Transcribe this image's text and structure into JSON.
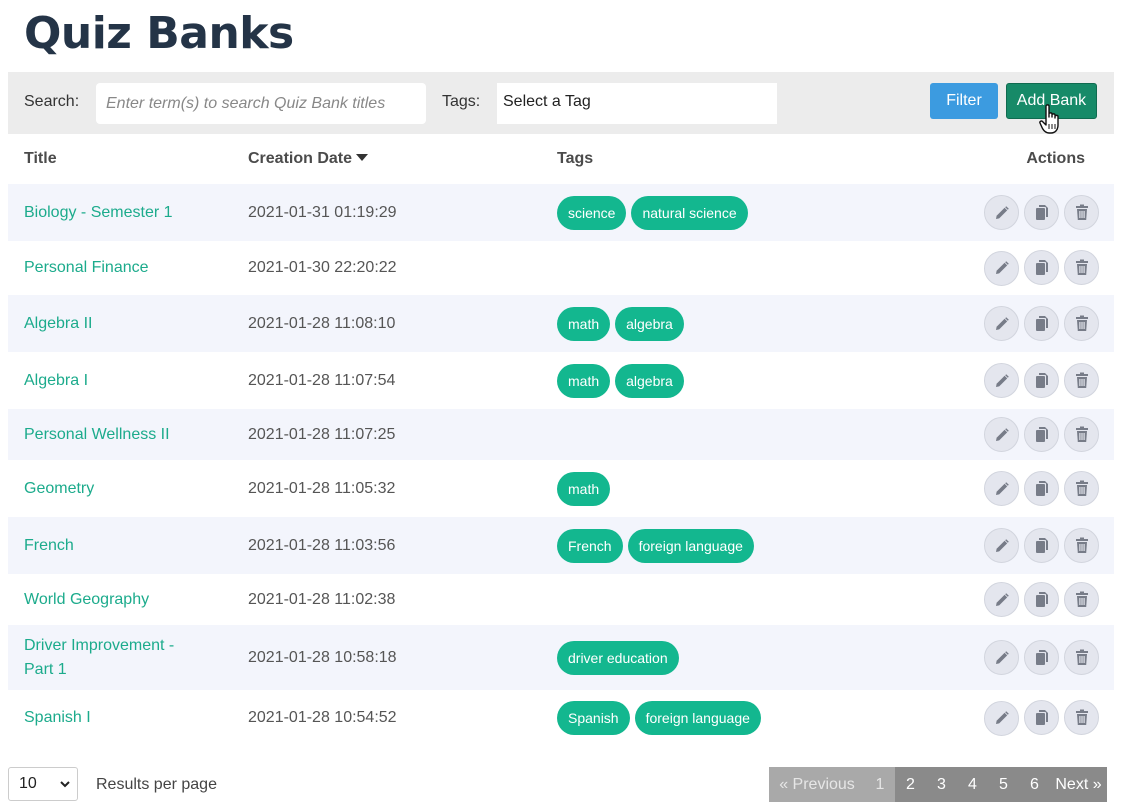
{
  "page": {
    "title": "Quiz Banks"
  },
  "filter": {
    "search_label": "Search:",
    "search_placeholder": "Enter term(s) to search Quiz Bank titles",
    "tags_label": "Tags:",
    "tags_value": "Select a Tag",
    "filter_button": "Filter",
    "add_button": "Add Bank"
  },
  "table": {
    "headers": {
      "title": "Title",
      "date": "Creation Date",
      "tags": "Tags",
      "actions": "Actions"
    },
    "sort": {
      "column": "Creation Date",
      "direction": "descending"
    },
    "action_icons": [
      "edit-icon",
      "copy-icon",
      "trash-icon"
    ],
    "rows": [
      {
        "title": "Biology - Semester 1",
        "date": "2021-01-31 01:19:29",
        "tags": [
          "science",
          "natural science"
        ]
      },
      {
        "title": "Personal Finance",
        "date": "2021-01-30 22:20:22",
        "tags": []
      },
      {
        "title": "Algebra II",
        "date": "2021-01-28 11:08:10",
        "tags": [
          "math",
          "algebra"
        ]
      },
      {
        "title": "Algebra I",
        "date": "2021-01-28 11:07:54",
        "tags": [
          "math",
          "algebra"
        ]
      },
      {
        "title": "Personal Wellness II",
        "date": "2021-01-28 11:07:25",
        "tags": []
      },
      {
        "title": "Geometry",
        "date": "2021-01-28 11:05:32",
        "tags": [
          "math"
        ]
      },
      {
        "title": "French",
        "date": "2021-01-28 11:03:56",
        "tags": [
          "French",
          "foreign language"
        ]
      },
      {
        "title": "World Geography",
        "date": "2021-01-28 11:02:38",
        "tags": []
      },
      {
        "title": "Driver Improvement - Part 1",
        "date": "2021-01-28 10:58:18",
        "tags": [
          "driver education"
        ]
      },
      {
        "title": "Spanish I",
        "date": "2021-01-28 10:54:52",
        "tags": [
          "Spanish",
          "foreign language"
        ]
      }
    ]
  },
  "footer": {
    "per_page_value": "10",
    "per_page_label": "Results per page",
    "pagination": {
      "previous": "« Previous",
      "next": "Next »",
      "pages": [
        "1",
        "2",
        "3",
        "4",
        "5",
        "6"
      ],
      "current": "1"
    }
  },
  "colors": {
    "link": "#1cab8c",
    "tag": "#13b78f",
    "filter_button": "#3c9be0",
    "add_button": "#178a68",
    "title": "#243447"
  }
}
